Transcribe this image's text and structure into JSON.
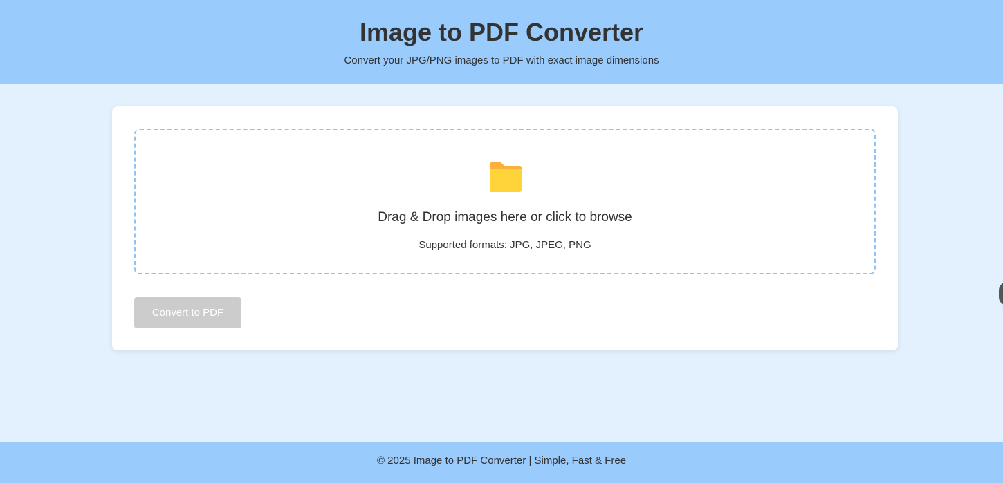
{
  "header": {
    "title": "Image to PDF Converter",
    "subtitle": "Convert your JPG/PNG images to PDF with exact image dimensions"
  },
  "dropzone": {
    "icon": "folder-icon",
    "instruction": "Drag & Drop images here or click to browse",
    "formats": "Supported formats: JPG, JPEG, PNG"
  },
  "actions": {
    "convert_label": "Convert to PDF",
    "convert_enabled": false
  },
  "footer": {
    "text": "© 2025 Image to PDF Converter | Simple, Fast & Free"
  },
  "colors": {
    "header_bg": "#99cbfd",
    "page_bg": "#e3f0fd",
    "dropzone_border": "#8fc4f2",
    "button_disabled": "#cccccc",
    "folder_back": "#fbb03b",
    "folder_front": "#ffd43b"
  }
}
